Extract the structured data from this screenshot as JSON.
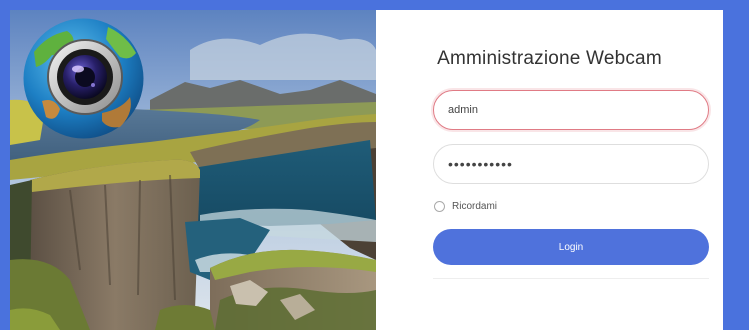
{
  "login": {
    "title": "Amministrazione Webcam",
    "username_value": "admin",
    "password_value": "•••••••••••",
    "remember_label": "Ricordami",
    "login_button_label": "Login"
  },
  "icons": {
    "logo": "webcam-globe-icon",
    "checkbox": "radio-circle-icon"
  },
  "colors": {
    "page_background": "#4a72dd",
    "button": "#4f72dc",
    "active_field_border": "#e07b85",
    "title_text": "#333333"
  }
}
